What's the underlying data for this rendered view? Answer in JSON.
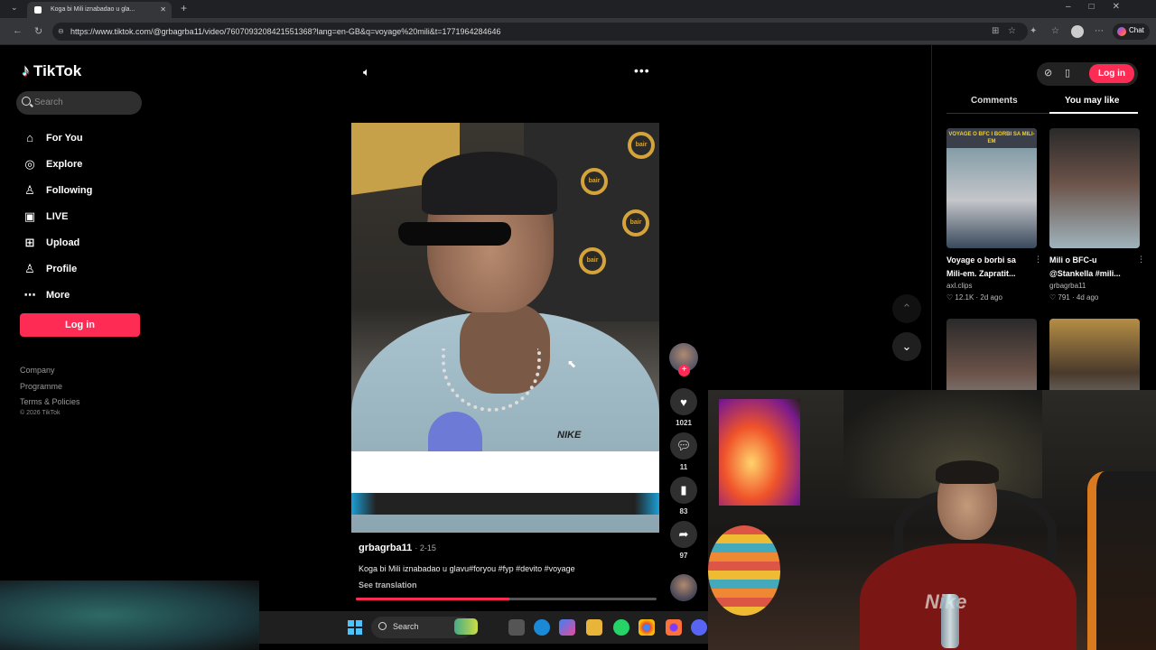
{
  "browser": {
    "tab_title": "Koga bi Mili iznabadao u gla...",
    "url": "https://www.tiktok.com/@grbagrba11/video/7607093208421551368?lang=en-GB&q=voyage%20mili&t=1771964284646",
    "chat_label": "Chat"
  },
  "sidebar": {
    "logo": "TikTok",
    "search_placeholder": "Search",
    "items": [
      {
        "label": "For You",
        "icon": "home-icon"
      },
      {
        "label": "Explore",
        "icon": "compass-icon"
      },
      {
        "label": "Following",
        "icon": "user-follow-icon"
      },
      {
        "label": "LIVE",
        "icon": "live-tv-icon"
      },
      {
        "label": "Upload",
        "icon": "plus-square-icon"
      },
      {
        "label": "Profile",
        "icon": "person-icon"
      },
      {
        "label": "More",
        "icon": "more-dots-icon"
      }
    ],
    "login_label": "Log in",
    "footer_links": [
      "Company",
      "Programme",
      "Terms & Policies"
    ],
    "copyright": "© 2026 TikTok"
  },
  "video": {
    "brand_text": "bair",
    "shirt_logo": "NIKE",
    "progress": 0.51
  },
  "actions": {
    "likes": "1021",
    "comments": "11",
    "saves": "83",
    "shares": "97"
  },
  "caption": {
    "username": "grbagrba11",
    "date": "· 2-15",
    "text": "Koga bi Mili iznabadao u glavu#foryou #fyp #devito #voyage",
    "translate": "See translation"
  },
  "right_panel": {
    "login_label": "Log in",
    "tabs": [
      "Comments",
      "You may like"
    ],
    "active_tab": "You may like",
    "cards": [
      {
        "title": "Voyage o borbi sa Mili-em. Zapratit...",
        "author": "axl.clips",
        "likes": "12.1K",
        "age": "2d ago",
        "banner": "VOYAGE O BFC I BORBI SA MILI-EM"
      },
      {
        "title": "Mili o BFC-u @Stankella #mili...",
        "author": "grbagrba11",
        "likes": "791",
        "age": "4d ago"
      }
    ]
  },
  "taskbar": {
    "search_label": "Search"
  },
  "webcam": {
    "shirt_text": "Nike"
  },
  "colors": {
    "brand_red": "#fe2c55",
    "bg": "#000000"
  }
}
